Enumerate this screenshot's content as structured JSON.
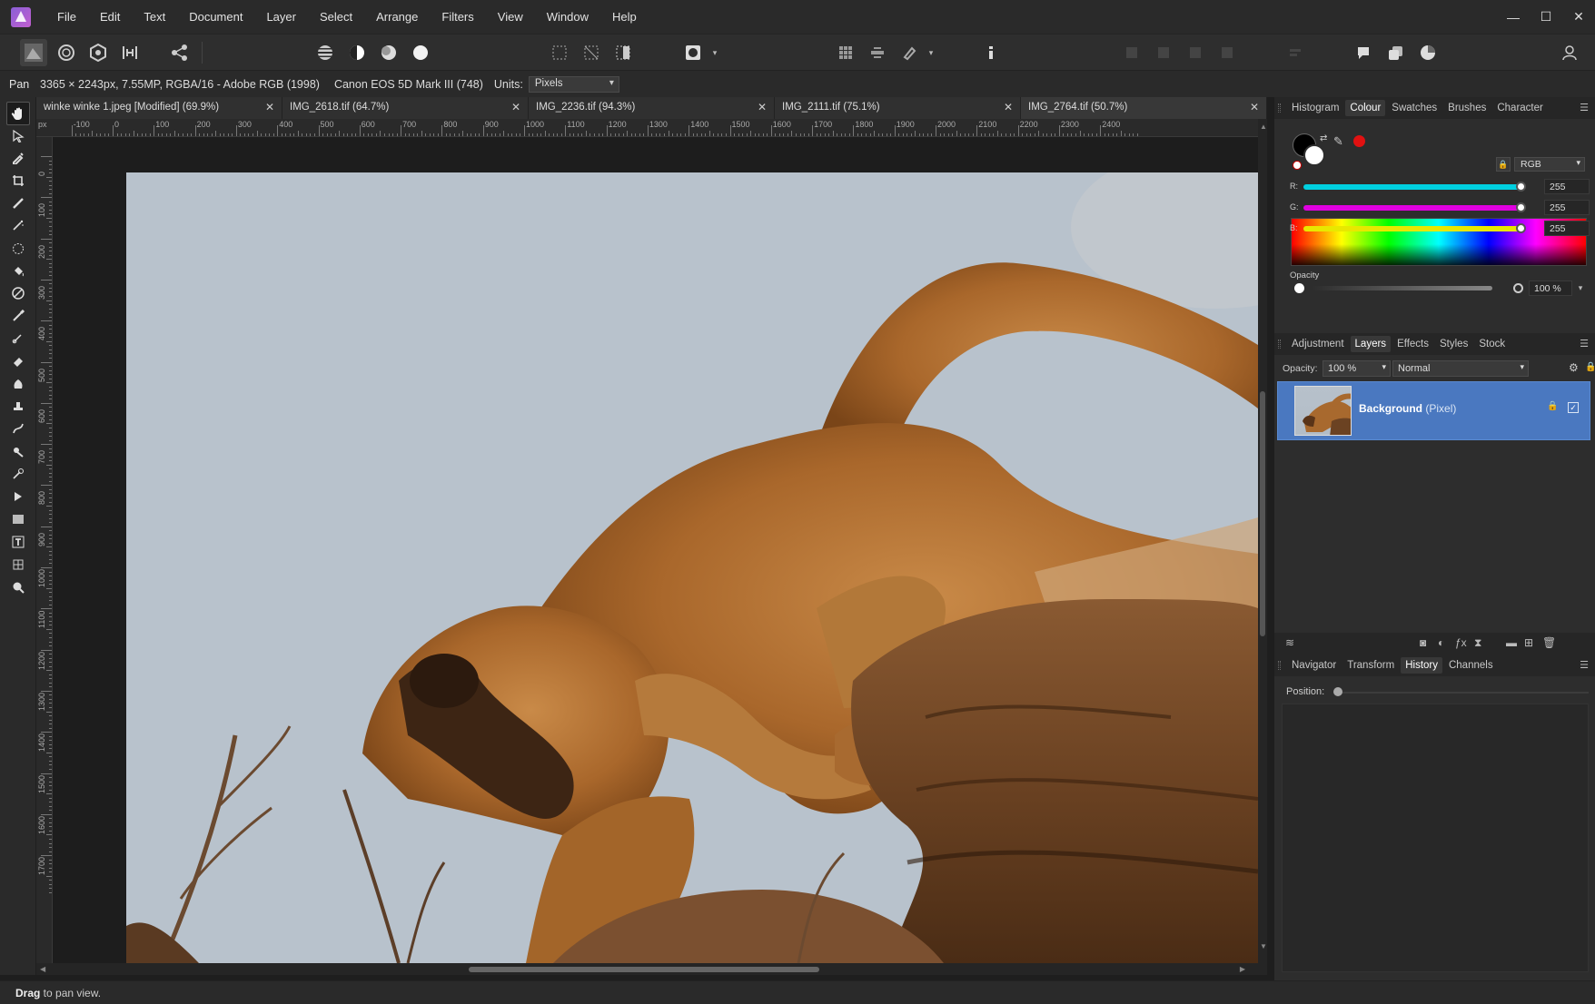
{
  "menu": [
    "File",
    "Edit",
    "Text",
    "Document",
    "Layer",
    "Select",
    "Arrange",
    "Filters",
    "View",
    "Window",
    "Help"
  ],
  "window_controls": {
    "minimize": "—",
    "maximize": "☐",
    "close": "✕"
  },
  "context": {
    "tool": "Pan",
    "image_info": "3365 × 2243px, 7.55MP, RGBA/16 - Adobe RGB (1998)",
    "camera": "Canon EOS 5D Mark III (748)",
    "units_label": "Units:",
    "units_value": "Pixels"
  },
  "doc_tabs": [
    {
      "label": "winke winke 1.jpeg [Modified] (69.9%)",
      "close": "✕"
    },
    {
      "label": "IMG_2618.tif (64.7%)",
      "close": "✕"
    },
    {
      "label": "IMG_2236.tif (94.3%)",
      "close": "✕"
    },
    {
      "label": "IMG_2111.tif (75.1%)",
      "close": "✕"
    },
    {
      "label": "IMG_2764.tif (50.7%)",
      "close": "✕"
    }
  ],
  "ruler": {
    "unit": "px",
    "top_labels": [
      "-100",
      "0",
      "100",
      "200",
      "300",
      "400",
      "500",
      "600",
      "700",
      "800",
      "900",
      "1000",
      "1100",
      "1200",
      "1300",
      "1400",
      "1500",
      "1600",
      "1700",
      "1800",
      "1900",
      "2000",
      "2100",
      "2200",
      "2300",
      "2400"
    ],
    "left_labels": [
      "0",
      "100",
      "200",
      "300",
      "400",
      "500",
      "600",
      "700",
      "800",
      "900",
      "1000",
      "1100",
      "1200",
      "1300",
      "1400",
      "1500",
      "1600",
      "1700"
    ]
  },
  "status": {
    "bold": "Drag",
    "text": " to pan view."
  },
  "colour_panel": {
    "tabs": [
      "Histogram",
      "Colour",
      "Swatches",
      "Brushes",
      "Character"
    ],
    "active_tab": "Colour",
    "model": "RGB",
    "sliders": [
      {
        "label": "R:",
        "value": "255",
        "color": "#00d0e0"
      },
      {
        "label": "G:",
        "value": "255",
        "color": "#e000e0"
      },
      {
        "label": "B:",
        "value": "255",
        "color": "#e8e800"
      }
    ],
    "picked_colour": "#e11111",
    "opacity_label": "Opacity",
    "opacity_value": "100 %"
  },
  "layers_panel": {
    "tabs": [
      "Adjustment",
      "Layers",
      "Effects",
      "Styles",
      "Stock"
    ],
    "active_tab": "Layers",
    "opacity_label": "Opacity:",
    "opacity_value": "100 %",
    "blend_mode": "Normal",
    "layers": [
      {
        "name": "Background",
        "type": "(Pixel)"
      }
    ]
  },
  "history_panel": {
    "tabs": [
      "Navigator",
      "Transform",
      "History",
      "Channels"
    ],
    "active_tab": "History",
    "position_label": "Position:"
  }
}
